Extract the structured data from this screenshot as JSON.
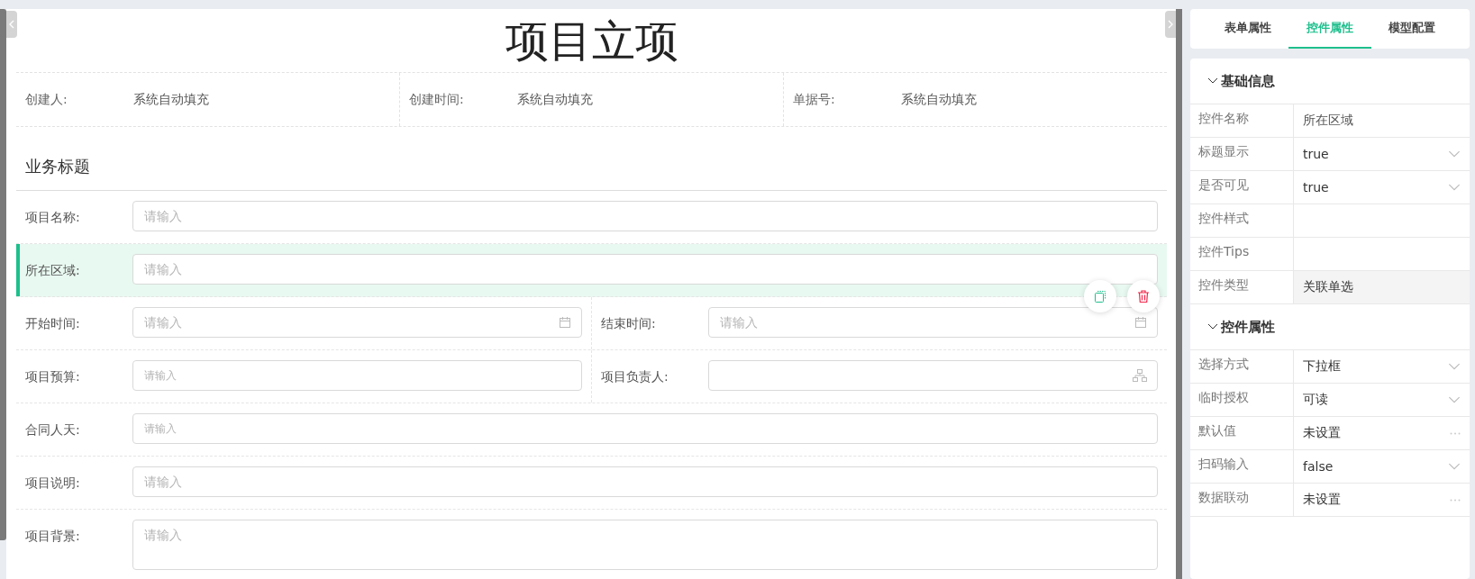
{
  "form": {
    "title": "项目立项",
    "meta": [
      {
        "label": "创建人:",
        "value": "系统自动填充"
      },
      {
        "label": "创建时间:",
        "value": "系统自动填充"
      },
      {
        "label": "单据号:",
        "value": "系统自动填充"
      }
    ],
    "section": "业务标题",
    "rows": [
      {
        "selected": false,
        "fields": [
          {
            "label": "项目名称:",
            "kind": "text",
            "placeholder": "请输入"
          }
        ]
      },
      {
        "selected": true,
        "fields": [
          {
            "label": "所在区域:",
            "kind": "text",
            "placeholder": "请输入"
          }
        ]
      },
      {
        "selected": false,
        "fields": [
          {
            "label": "开始时间:",
            "kind": "date",
            "placeholder": "请输入"
          },
          {
            "label": "结束时间:",
            "kind": "date",
            "placeholder": "请输入"
          }
        ]
      },
      {
        "selected": false,
        "fields": [
          {
            "label": "项目预算:",
            "kind": "number",
            "placeholder": "请输入"
          },
          {
            "label": "项目负责人:",
            "kind": "picker"
          }
        ]
      },
      {
        "selected": false,
        "fields": [
          {
            "label": "合同人天:",
            "kind": "number",
            "placeholder": "请输入"
          }
        ]
      },
      {
        "selected": false,
        "fields": [
          {
            "label": "项目说明:",
            "kind": "text",
            "placeholder": "请输入"
          }
        ]
      },
      {
        "selected": false,
        "fields": [
          {
            "label": "项目背景:",
            "kind": "textarea",
            "placeholder": "请输入"
          }
        ]
      }
    ]
  },
  "panel": {
    "tabs": [
      {
        "label": "表单属性",
        "selected": false
      },
      {
        "label": "控件属性",
        "selected": true
      },
      {
        "label": "模型配置",
        "selected": false
      }
    ],
    "sections": [
      {
        "title": "基础信息",
        "expanded": true,
        "rows": [
          {
            "label": "控件名称",
            "kind": "text",
            "value": "所在区域"
          },
          {
            "label": "标题显示",
            "kind": "select",
            "value": "true"
          },
          {
            "label": "是否可见",
            "kind": "select",
            "value": "true"
          },
          {
            "label": "控件样式",
            "kind": "text"
          },
          {
            "label": "控件Tips",
            "kind": "text"
          },
          {
            "label": "控件类型",
            "kind": "readonly",
            "value": "关联单选"
          }
        ]
      },
      {
        "title": "控件属性",
        "expanded": true,
        "rows": [
          {
            "label": "选择方式",
            "kind": "select",
            "value": "下拉框"
          },
          {
            "label": "临时授权",
            "kind": "select",
            "value": "可读"
          },
          {
            "label": "默认值",
            "kind": "dialog",
            "value": "未设置"
          },
          {
            "label": "扫码输入",
            "kind": "select",
            "value": "false"
          },
          {
            "label": "数据联动",
            "kind": "dialog",
            "value": "未设置"
          }
        ]
      }
    ]
  }
}
